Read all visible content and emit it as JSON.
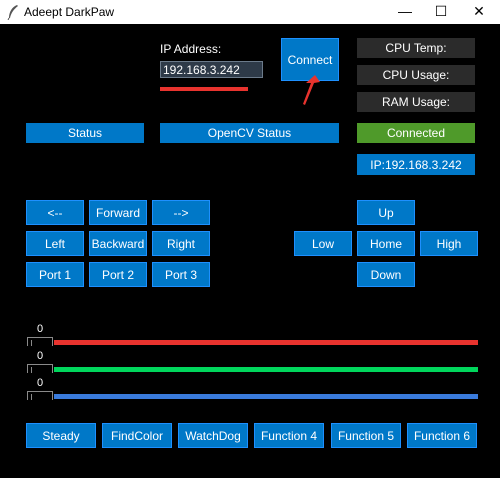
{
  "window": {
    "title": "Adeept DarkPaw",
    "minimize_glyph": "—",
    "maximize_glyph": "☐",
    "close_glyph": "✕"
  },
  "connection": {
    "ip_label": "IP Address:",
    "ip_value": "192.168.3.242",
    "connect_label": "Connect",
    "status_connected": "Connected",
    "ip_display": "IP:192.168.3.242"
  },
  "metrics": {
    "cpu_temp": "CPU Temp:",
    "cpu_usage": "CPU Usage:",
    "ram_usage": "RAM Usage:"
  },
  "status": {
    "status_label": "Status",
    "opencv_label": "OpenCV Status"
  },
  "movement": {
    "turn_left": "<--",
    "forward": "Forward",
    "turn_right": "-->",
    "left": "Left",
    "backward": "Backward",
    "right": "Right",
    "port1": "Port 1",
    "port2": "Port 2",
    "port3": "Port 3"
  },
  "height": {
    "up": "Up",
    "low": "Low",
    "home": "Home",
    "high": "High",
    "down": "Down"
  },
  "sliders": [
    {
      "value": "0",
      "color": "#e8332e"
    },
    {
      "value": "0",
      "color": "#00d65c"
    },
    {
      "value": "0",
      "color": "#3a7bdc"
    }
  ],
  "functions": {
    "steady": "Steady",
    "findcolor": "FindColor",
    "watchdog": "WatchDog",
    "function4": "Function 4",
    "function5": "Function 5",
    "function6": "Function 6"
  },
  "colors": {
    "button_blue": "#0078c8",
    "connected_green": "#4f9a2a",
    "annotation_red": "#e8332e"
  }
}
